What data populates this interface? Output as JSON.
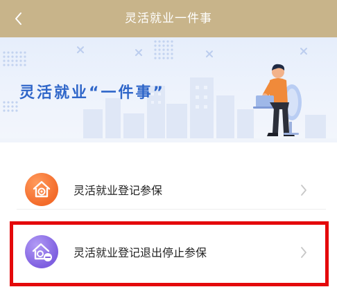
{
  "header": {
    "back_icon": "chevron-left-icon",
    "title": "灵活就业一件事"
  },
  "banner": {
    "title": "灵活就业“一件事”"
  },
  "menu": {
    "items": [
      {
        "label": "灵活就业登记参保",
        "icon": "house-shield-icon",
        "icon_color": "#f36b2a"
      },
      {
        "label": "灵活就业登记退出停止参保",
        "icon": "house-stop-icon",
        "icon_color": "#7e5fe0"
      }
    ]
  },
  "colors": {
    "header_bg": "#c8b48a",
    "banner_title": "#2f66c9",
    "highlight": "#e4090b"
  }
}
